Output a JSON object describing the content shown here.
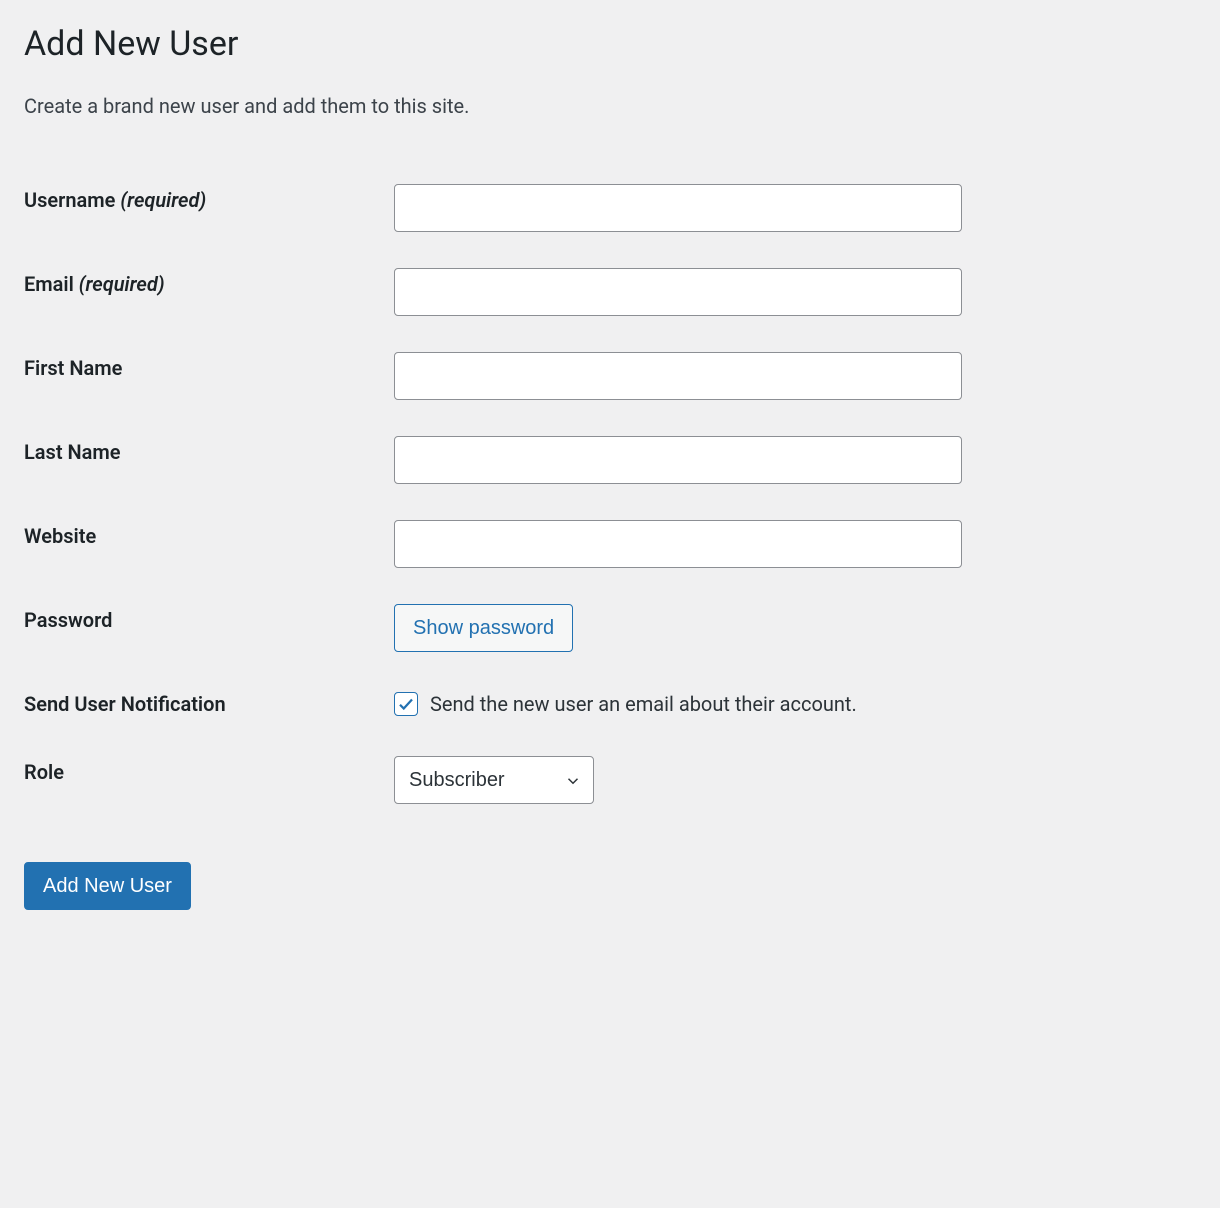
{
  "page": {
    "title": "Add New User",
    "description": "Create a brand new user and add them to this site."
  },
  "fields": {
    "username": {
      "label": "Username ",
      "required_text": "(required)",
      "value": ""
    },
    "email": {
      "label": "Email ",
      "required_text": "(required)",
      "value": ""
    },
    "first_name": {
      "label": "First Name",
      "value": ""
    },
    "last_name": {
      "label": "Last Name",
      "value": ""
    },
    "website": {
      "label": "Website",
      "value": ""
    },
    "password": {
      "label": "Password",
      "button_label": "Show password"
    },
    "notification": {
      "label": "Send User Notification",
      "checkbox_label": "Send the new user an email about their account.",
      "checked": true
    },
    "role": {
      "label": "Role",
      "selected": "Subscriber"
    }
  },
  "submit": {
    "label": "Add New User"
  }
}
